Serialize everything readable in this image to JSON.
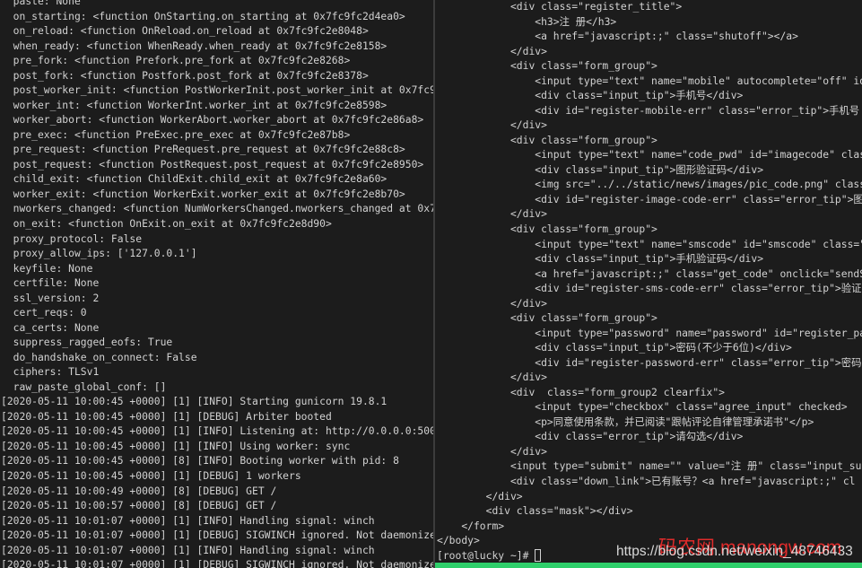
{
  "colors": {
    "background": "#1c1c1c",
    "text": "#d2d2d2",
    "divider": "#3c3c3c",
    "status_bar": "#2fcf6b",
    "watermark_red": "#e02b2b"
  },
  "icons": {
    "cursor": "block-cursor-icon"
  },
  "left_pane": {
    "lines": [
      "  paste: None",
      "  on_starting: <function OnStarting.on_starting at 0x7fc9fc2d4ea0>",
      "  on_reload: <function OnReload.on_reload at 0x7fc9fc2e8048>",
      "  when_ready: <function WhenReady.when_ready at 0x7fc9fc2e8158>",
      "  pre_fork: <function Prefork.pre_fork at 0x7fc9fc2e8268>",
      "  post_fork: <function Postfork.post_fork at 0x7fc9fc2e8378>",
      "  post_worker_init: <function PostWorkerInit.post_worker_init at 0x7fc9",
      "  worker_int: <function WorkerInt.worker_int at 0x7fc9fc2e8598>",
      "  worker_abort: <function WorkerAbort.worker_abort at 0x7fc9fc2e86a8>",
      "  pre_exec: <function PreExec.pre_exec at 0x7fc9fc2e87b8>",
      "  pre_request: <function PreRequest.pre_request at 0x7fc9fc2e88c8>",
      "  post_request: <function PostRequest.post_request at 0x7fc9fc2e8950>",
      "  child_exit: <function ChildExit.child_exit at 0x7fc9fc2e8a60>",
      "  worker_exit: <function WorkerExit.worker_exit at 0x7fc9fc2e8b70>",
      "  nworkers_changed: <function NumWorkersChanged.nworkers_changed at 0x7",
      "  on_exit: <function OnExit.on_exit at 0x7fc9fc2e8d90>",
      "  proxy_protocol: False",
      "  proxy_allow_ips: ['127.0.0.1']",
      "  keyfile: None",
      "  certfile: None",
      "  ssl_version: 2",
      "  cert_reqs: 0",
      "  ca_certs: None",
      "  suppress_ragged_eofs: True",
      "  do_handshake_on_connect: False",
      "  ciphers: TLSv1",
      "  raw_paste_global_conf: []",
      "[2020-05-11 10:00:45 +0000] [1] [INFO] Starting gunicorn 19.8.1",
      "[2020-05-11 10:00:45 +0000] [1] [DEBUG] Arbiter booted",
      "[2020-05-11 10:00:45 +0000] [1] [INFO] Listening at: http://0.0.0.0:500",
      "[2020-05-11 10:00:45 +0000] [1] [INFO] Using worker: sync",
      "[2020-05-11 10:00:45 +0000] [8] [INFO] Booting worker with pid: 8",
      "[2020-05-11 10:00:45 +0000] [1] [DEBUG] 1 workers",
      "[2020-05-11 10:00:49 +0000] [8] [DEBUG] GET /",
      "[2020-05-11 10:00:57 +0000] [8] [DEBUG] GET /",
      "[2020-05-11 10:01:07 +0000] [1] [INFO] Handling signal: winch",
      "[2020-05-11 10:01:07 +0000] [1] [DEBUG] SIGWINCH ignored. Not daemonize",
      "[2020-05-11 10:01:07 +0000] [1] [INFO] Handling signal: winch",
      "[2020-05-11 10:01:07 +0000] [1] [DEBUG] SIGWINCH ignored. Not daemonize"
    ]
  },
  "right_pane": {
    "lines": [
      "            <div class=\"register_title\">",
      "                <h3>注 册</h3>",
      "                <a href=\"javascript:;\" class=\"shutoff\"></a>",
      "            </div>",
      "            <div class=\"form_group\">",
      "                <input type=\"text\" name=\"mobile\" autocomplete=\"off\" id",
      "                <div class=\"input_tip\">手机号</div>",
      "                <div id=\"register-mobile-err\" class=\"error_tip\">手机号",
      "            </div>",
      "            <div class=\"form_group\">",
      "                <input type=\"text\" name=\"code_pwd\" id=\"imagecode\" class",
      "                <div class=\"input_tip\">图形验证码</div>",
      "                <img src=\"../../static/news/images/pic_code.png\" class",
      "                <div id=\"register-image-code-err\" class=\"error_tip\">图",
      "            </div>",
      "            <div class=\"form_group\">",
      "                <input type=\"text\" name=\"smscode\" id=\"smscode\" class=\"",
      "                <div class=\"input_tip\">手机验证码</div>",
      "                <a href=\"javascript:;\" class=\"get_code\" onclick=\"sendS",
      "                <div id=\"register-sms-code-err\" class=\"error_tip\">验证",
      "            </div>",
      "            <div class=\"form_group\">",
      "                <input type=\"password\" name=\"password\" id=\"register_pa",
      "                <div class=\"input_tip\">密码(不少于6位)</div>",
      "                <div id=\"register-password-err\" class=\"error_tip\">密码",
      "            </div>",
      "            <div  class=\"form_group2 clearfix\">",
      "                <input type=\"checkbox\" class=\"agree_input\" checked>",
      "                <p>同意使用条款，并已阅读\"跟帖评论自律管理承诺书\"</p>",
      "                <div class=\"error_tip\">请勾选</div>",
      "            </div>",
      "            <input type=\"submit\" name=\"\" value=\"注 册\" class=\"input_su",
      "            <div class=\"down_link\">已有账号？<a href=\"javascript:;\" cl",
      "        </div>",
      "        <div class=\"mask\"></div>",
      "    </form>",
      "</body>"
    ],
    "prompt": "[root@lucky ~]# "
  },
  "watermark": {
    "site_cn": "码农网",
    "site_en": "manongw.com",
    "url": "https://blog.csdn.net/weixin_48746433"
  }
}
